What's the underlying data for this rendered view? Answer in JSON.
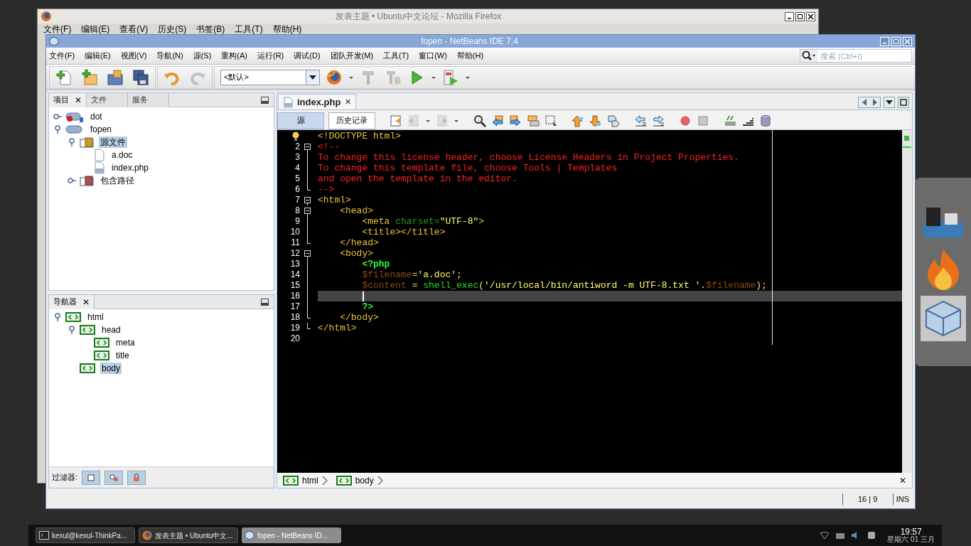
{
  "firefox_window": {
    "title": "发表主题 • Ubuntu中文论坛 - Mozilla Firefox",
    "menu": [
      "文件(F)",
      "编辑(E)",
      "查看(V)",
      "历史(S)",
      "书签(B)",
      "工具(T)",
      "帮助(H)"
    ]
  },
  "netbeans_window": {
    "title": "fopen - NetBeans IDE 7.4",
    "menu": [
      "文件(F)",
      "编辑(E)",
      "视图(V)",
      "导航(N)",
      "源(S)",
      "重构(A)",
      "运行(R)",
      "调试(D)",
      "团队开发(M)",
      "工具(T)",
      "窗口(W)",
      "帮助(H)"
    ],
    "search": {
      "placeholder": "搜索 (Ctrl+I)"
    },
    "configuration": "<默认>"
  },
  "projects_panel": {
    "tabs": [
      {
        "label": "项目",
        "selected": true,
        "close": "✕"
      },
      {
        "label": "文件",
        "selected": false
      },
      {
        "label": "服务",
        "selected": false
      }
    ],
    "tree": [
      {
        "label": "dot",
        "kind": "project-error",
        "expanded": false,
        "selected": false
      },
      {
        "label": "fopen",
        "kind": "project",
        "expanded": true,
        "selected": false,
        "children": [
          {
            "label": "源文件",
            "kind": "source-folder",
            "expanded": true,
            "selected": true,
            "children": [
              {
                "label": "a.doc",
                "kind": "file",
                "selected": false
              },
              {
                "label": "index.php",
                "kind": "php-file",
                "selected": false
              }
            ]
          },
          {
            "label": "包含路径",
            "kind": "library-folder",
            "expanded": false,
            "selected": false
          }
        ]
      }
    ]
  },
  "navigator_panel": {
    "tabs": [
      {
        "label": "导航器",
        "selected": true,
        "close": "✕"
      }
    ],
    "tree": [
      {
        "label": "html",
        "expanded": true,
        "selected": false,
        "children": [
          {
            "label": "head",
            "expanded": true,
            "selected": false,
            "children": [
              {
                "label": "meta",
                "selected": false
              },
              {
                "label": "title",
                "selected": false
              }
            ]
          },
          {
            "label": "body",
            "selected": true
          }
        ]
      }
    ],
    "filter_label": "过滤器:"
  },
  "editor": {
    "tabs": [
      {
        "label": "index.php",
        "selected": true,
        "close": "✕"
      }
    ],
    "views": [
      {
        "label": "源",
        "selected": true
      },
      {
        "label": "历史记录",
        "selected": false
      }
    ],
    "lines": [
      {
        "hint": true,
        "tokens": [
          {
            "text": "<!DOCTYPE html>",
            "kind": "tag"
          }
        ]
      },
      {
        "number": "2",
        "fold_start": true,
        "tokens": [
          {
            "text": "<!--",
            "kind": "comment"
          }
        ]
      },
      {
        "number": "3",
        "in_fold": true,
        "tokens": [
          {
            "text": "To change this license header, choose License Headers in Project Properties.",
            "kind": "comment"
          }
        ]
      },
      {
        "number": "4",
        "in_fold": true,
        "tokens": [
          {
            "text": "To change this template file, choose Tools | Templates",
            "kind": "comment"
          }
        ]
      },
      {
        "number": "5",
        "in_fold": true,
        "tokens": [
          {
            "text": "and open the template in the editor.",
            "kind": "comment"
          }
        ]
      },
      {
        "number": "6",
        "fold_end": true,
        "tokens": [
          {
            "text": "-->",
            "kind": "comment"
          }
        ]
      },
      {
        "number": "7",
        "fold_start": true,
        "tokens": [
          {
            "text": "<html>",
            "kind": "tag"
          }
        ]
      },
      {
        "number": "8",
        "fold_start": true,
        "tokens": [
          {
            "text": "    <head>",
            "kind": "tag"
          }
        ]
      },
      {
        "number": "9",
        "in_fold": true,
        "tokens": [
          {
            "text": "        <meta",
            "kind": "tag"
          },
          {
            "text": " charset=",
            "kind": "attribute"
          },
          {
            "text": "\"UTF-8\"",
            "kind": "string"
          },
          {
            "text": ">",
            "kind": "tag"
          }
        ]
      },
      {
        "number": "10",
        "in_fold": true,
        "tokens": [
          {
            "text": "        <title></title>",
            "kind": "tag"
          }
        ]
      },
      {
        "number": "11",
        "fold_end": true,
        "tokens": [
          {
            "text": "    </head>",
            "kind": "tag"
          }
        ]
      },
      {
        "number": "12",
        "fold_start": true,
        "tokens": [
          {
            "text": "    <body>",
            "kind": "tag"
          }
        ]
      },
      {
        "number": "13",
        "in_fold": true,
        "tokens": [
          {
            "text": "        <?php",
            "kind": "php"
          }
        ]
      },
      {
        "number": "14",
        "in_fold": true,
        "tokens": [
          {
            "text": "        $filename",
            "kind": "variable"
          },
          {
            "text": "=",
            "kind": "operator"
          },
          {
            "text": "'a.doc'",
            "kind": "string"
          },
          {
            "text": ";",
            "kind": "operator"
          }
        ]
      },
      {
        "number": "15",
        "in_fold": true,
        "tokens": [
          {
            "text": "        $content",
            "kind": "variable"
          },
          {
            "text": " = ",
            "kind": "operator"
          },
          {
            "text": "shell_exec",
            "kind": "function"
          },
          {
            "text": "(",
            "kind": "operator"
          },
          {
            "text": "'/usr/local/bin/antiword -m UTF-8.txt '",
            "kind": "string"
          },
          {
            "text": ".",
            "kind": "operator"
          },
          {
            "text": "$filename",
            "kind": "variable"
          },
          {
            "text": ");",
            "kind": "operator"
          }
        ]
      },
      {
        "number": "16",
        "in_fold": true,
        "current": true
      },
      {
        "number": "17",
        "in_fold": true,
        "tokens": [
          {
            "text": "        ?>",
            "kind": "php"
          }
        ]
      },
      {
        "number": "18",
        "fold_end": true,
        "tokens": [
          {
            "text": "    </body>",
            "kind": "tag"
          }
        ]
      },
      {
        "number": "19",
        "fold_end": true,
        "tokens": [
          {
            "text": "</html>",
            "kind": "tag"
          }
        ]
      },
      {
        "number": "20"
      }
    ],
    "breadcrumbs": [
      "html",
      "body"
    ],
    "breadcrumb_close": "✕"
  },
  "status_bar": {
    "position": "16 | 9",
    "mode": "INS"
  },
  "taskbar": {
    "tasks": [
      {
        "label": "kexul@kexul-ThinkPa...",
        "kind": "terminal",
        "selected": false
      },
      {
        "label": "发表主题 • Ubuntu中文...",
        "kind": "browser",
        "selected": false
      },
      {
        "label": "fopen - NetBeans ID...",
        "kind": "ide",
        "selected": true
      }
    ],
    "time": "19:57",
    "date": "星期六 01 三月"
  }
}
